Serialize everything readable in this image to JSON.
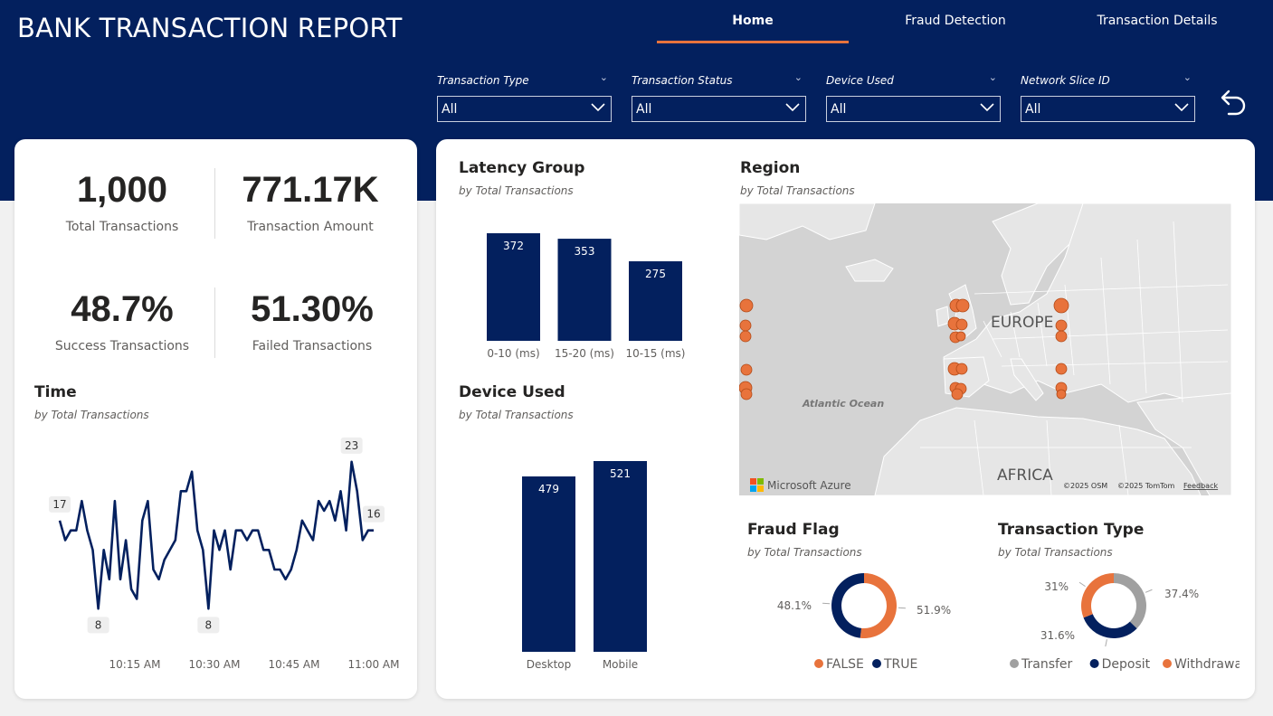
{
  "header": {
    "title": "BANK TRANSACTION REPORT",
    "tabs": [
      {
        "label": "Home",
        "active": true
      },
      {
        "label": "Fraud Detection",
        "active": false
      },
      {
        "label": "Transaction Details",
        "active": false
      }
    ],
    "accent_color": "#e8733c",
    "background_color": "#03205e"
  },
  "filters": [
    {
      "label": "Transaction Type",
      "value": "All"
    },
    {
      "label": "Transaction Status",
      "value": "All"
    },
    {
      "label": "Device Used",
      "value": "All"
    },
    {
      "label": "Network Slice ID",
      "value": "All"
    }
  ],
  "kpis": {
    "total_transactions": {
      "value": "1,000",
      "label": "Total Transactions"
    },
    "transaction_amount": {
      "value": "771.17K",
      "label": "Transaction Amount"
    },
    "success": {
      "value": "48.7%",
      "label": "Success Transactions"
    },
    "failed": {
      "value": "51.30%",
      "label": "Failed Transactions"
    }
  },
  "time_chart": {
    "title": "Time",
    "subtitle": "by Total Transactions"
  },
  "latency_chart": {
    "title": "Latency Group",
    "subtitle": "by Total Transactions"
  },
  "device_chart": {
    "title": "Device Used",
    "subtitle": "by Total Transactions"
  },
  "region_map": {
    "title": "Region",
    "subtitle": "by Total Transactions",
    "labels": {
      "europe": "EUROPE",
      "ocean": "Atlantic Ocean",
      "africa": "AFRICA"
    },
    "brand": "Microsoft Azure",
    "copyright_osm": "©2025 OSM",
    "copyright_tomtom": "©2025 TomTom",
    "feedback": "Feedback"
  },
  "fraud_chart": {
    "title": "Fraud Flag",
    "subtitle": "by Total Transactions"
  },
  "type_chart": {
    "title": "Transaction Type",
    "subtitle": "by Total Transactions"
  },
  "chart_data": [
    {
      "type": "line",
      "title": "Time",
      "xticks": [
        "10:15 AM",
        "10:30 AM",
        "10:45 AM",
        "11:00 AM"
      ],
      "values": [
        17,
        15,
        16,
        16,
        19,
        16,
        14,
        8,
        14,
        11,
        19,
        11,
        15,
        10,
        9,
        17,
        19,
        12,
        11,
        13,
        14,
        15,
        20,
        20,
        22,
        16,
        14,
        8,
        16,
        14,
        16,
        12,
        16,
        16,
        15,
        16,
        16,
        14,
        14,
        12,
        12,
        11,
        12,
        14,
        17,
        16,
        15,
        19,
        18,
        19,
        17,
        20,
        16,
        23,
        20,
        15,
        16,
        16
      ]
    },
    {
      "type": "bar",
      "title": "Latency Group",
      "categories": [
        "0-10 (ms)",
        "15-20 (ms)",
        "10-15 (ms)"
      ],
      "values": [
        372,
        353,
        275
      ],
      "color": "#03205e"
    },
    {
      "type": "bar",
      "title": "Device Used",
      "categories": [
        "Desktop",
        "Mobile"
      ],
      "values": [
        479,
        521
      ],
      "color": "#03205e"
    },
    {
      "type": "pie",
      "title": "Fraud Flag",
      "slices": [
        {
          "name": "FALSE",
          "value": 51.9,
          "label": "51.9%",
          "color": "#e8733c"
        },
        {
          "name": "TRUE",
          "value": 48.1,
          "label": "48.1%",
          "color": "#03205e"
        }
      ]
    },
    {
      "type": "pie",
      "title": "Transaction Type",
      "slices": [
        {
          "name": "Transfer",
          "value": 37.4,
          "label": "37.4%",
          "color": "#a0a0a0"
        },
        {
          "name": "Deposit",
          "value": 31.6,
          "label": "31.6%",
          "color": "#03205e"
        },
        {
          "name": "Withdrawal",
          "value": 31.0,
          "label": "31%",
          "color": "#e8733c"
        }
      ]
    }
  ]
}
